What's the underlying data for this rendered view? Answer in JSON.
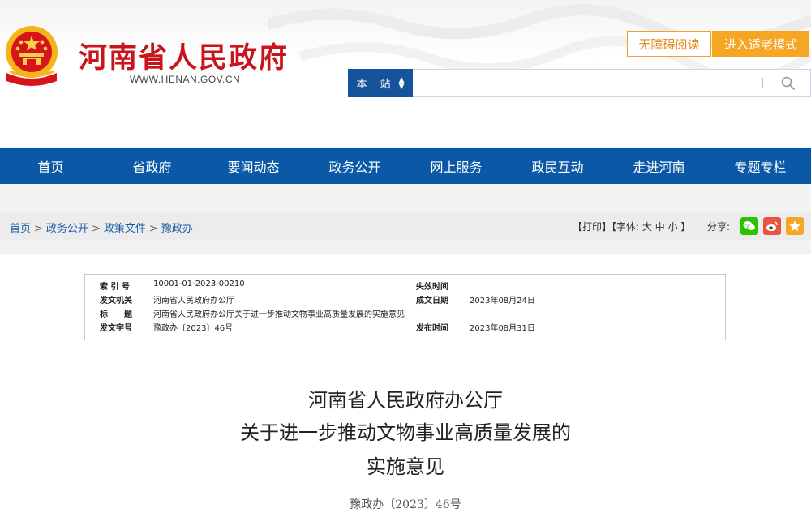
{
  "header": {
    "site_name": "河南省人民政府",
    "site_url": "WWW.HENAN.GOV.CN",
    "accessible_label": "无障碍阅读",
    "elder_mode_label": "进入适老模式",
    "search_scope": "本 站",
    "search_value": "",
    "search_placeholder": ""
  },
  "nav": {
    "items": [
      "首页",
      "省政府",
      "要闻动态",
      "政务公开",
      "网上服务",
      "政民互动",
      "走进河南",
      "专题专栏"
    ]
  },
  "breadcrumb": {
    "items": [
      "首页",
      "政务公开",
      "政策文件",
      "豫政办"
    ],
    "separator": ">"
  },
  "tools": {
    "print": "【打印】",
    "font_label": "【字体:",
    "font_large": "大",
    "font_medium": "中",
    "font_small": "小",
    "font_close": "】",
    "share_label": "分享:"
  },
  "share": {
    "wechat_icon": "wechat-icon",
    "weibo_icon": "weibo-icon",
    "favorite_icon": "star-icon",
    "colors": {
      "wechat": "#2dc100",
      "weibo": "#e8543f",
      "favorite": "#f5a623"
    }
  },
  "meta": {
    "index_label": "索 引 号",
    "index_value": "10001-01-2023-00210",
    "issuer_label": "发文机关",
    "issuer_value": "河南省人民政府办公厅",
    "title_label": "标　　题",
    "title_value": "河南省人民政府办公厅关于进一步推动文物事业高质量发展的实施意见",
    "docno_label": "发文字号",
    "docno_value": "豫政办〔2023〕46号",
    "expiry_label": "失效时间",
    "expiry_value": "",
    "written_label": "成文日期",
    "written_value": "2023年08月24日",
    "published_label": "发布时间",
    "published_value": "2023年08月31日"
  },
  "document": {
    "title_line1": "河南省人民政府办公厅",
    "title_line2": "关于进一步推动文物事业高质量发展的",
    "title_line3": "实施意见",
    "doc_number": "豫政办〔2023〕46号"
  },
  "colors": {
    "brand_red": "#c8141a",
    "nav_blue": "#0b58a7",
    "accent_orange": "#f5a623"
  }
}
